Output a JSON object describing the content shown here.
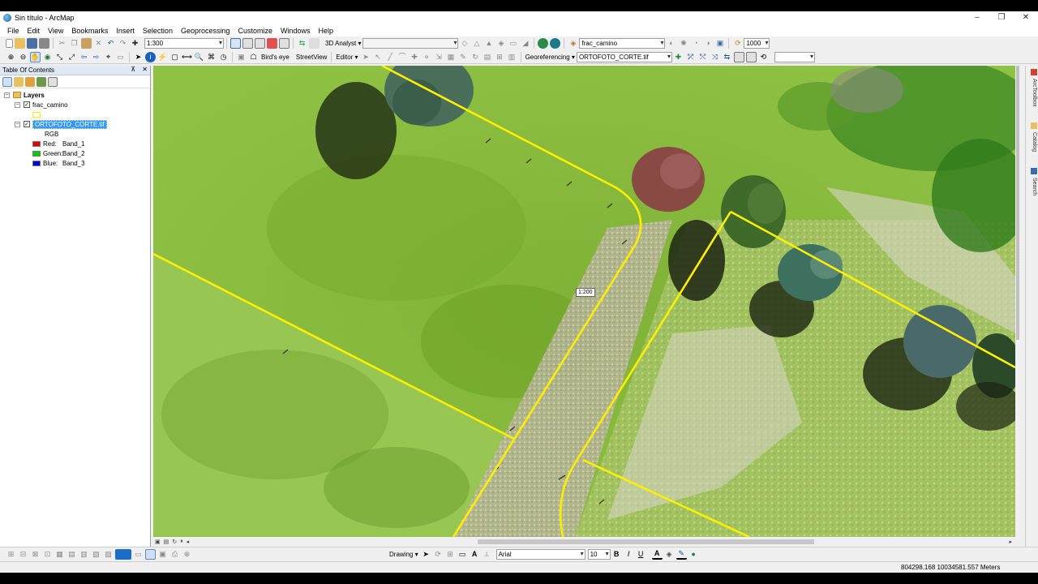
{
  "window": {
    "title": "Sin título - ArcMap",
    "minimize": "‒",
    "maximize": "❐",
    "close": "✕"
  },
  "menu": [
    "File",
    "Edit",
    "View",
    "Bookmarks",
    "Insert",
    "Selection",
    "Geoprocessing",
    "Customize",
    "Windows",
    "Help"
  ],
  "toolbar": {
    "scale_value": "1:300",
    "analyst_3d": "3D Analyst ▾",
    "layer_combo": "frac_camino",
    "zoom_value": "1000",
    "birds_eye": "Bird's eye",
    "street_view": "StreetView",
    "editor": "Editor ▾",
    "georef": "Georeferencing ▾",
    "georef_layer": "ORTOFOTO_CORTE.tif"
  },
  "toc": {
    "header": "Table Of Contents",
    "pin": "⊼",
    "close": "✕",
    "root": "Layers",
    "layers": [
      {
        "name": "frac_camino",
        "checked": "✓",
        "expand": "−"
      },
      {
        "name": "ORTOFOTO_CORTE.tif",
        "checked": "✓",
        "expand": "−"
      }
    ],
    "rgb_label": "RGB",
    "bands": [
      {
        "channel": "Red:",
        "band": "Band_1",
        "color": "#e00000"
      },
      {
        "channel": "Green:",
        "band": "Band_2",
        "color": "#00d000"
      },
      {
        "channel": "Blue:",
        "band": "Band_3",
        "color": "#0000e0"
      }
    ]
  },
  "map": {
    "scale_tip": "1:200",
    "boundary_color": "#ffee00"
  },
  "dock": [
    "ArcToolbox",
    "Catalog",
    "Search"
  ],
  "drawing": {
    "label": "Drawing ▾",
    "font": "Arial",
    "size": "10",
    "bold": "B",
    "italic": "I",
    "underline": "U",
    "font_color": "A"
  },
  "status": {
    "coords": "804298.168  10034581.557 Meters"
  }
}
